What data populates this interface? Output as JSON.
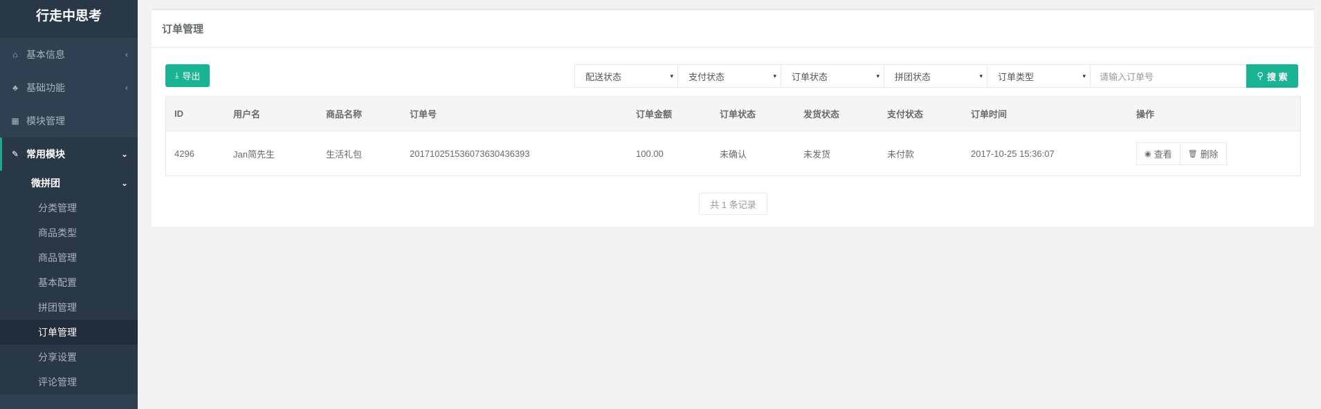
{
  "brand": {
    "title": "行走中思考"
  },
  "sidebar": {
    "items": [
      {
        "label": "基本信息",
        "icon": "home-icon",
        "glyph": "⌂",
        "chevron": "‹"
      },
      {
        "label": "基础功能",
        "icon": "sitemap-icon",
        "glyph": "♣",
        "chevron": "‹"
      },
      {
        "label": "模块管理",
        "icon": "grid-icon",
        "glyph": "▦",
        "chevron": ""
      },
      {
        "label": "常用模块",
        "icon": "edit-icon",
        "glyph": "✎",
        "chevron": "⌄"
      }
    ],
    "submenu": {
      "title": "微拼团",
      "chevron": "⌄",
      "items": [
        {
          "label": "分类管理"
        },
        {
          "label": "商品类型"
        },
        {
          "label": "商品管理"
        },
        {
          "label": "基本配置"
        },
        {
          "label": "拼团管理"
        },
        {
          "label": "订单管理"
        },
        {
          "label": "分享设置"
        },
        {
          "label": "评论管理"
        }
      ]
    }
  },
  "panel": {
    "title": "订单管理"
  },
  "toolbar": {
    "export_label": "导出",
    "export_icon": "⤓",
    "filters": [
      {
        "label": "配送状态"
      },
      {
        "label": "支付状态"
      },
      {
        "label": "订单状态"
      },
      {
        "label": "拼团状态"
      },
      {
        "label": "订单类型"
      }
    ],
    "caret": "▾",
    "search_placeholder": "请输入订单号",
    "search_label": "搜 索",
    "search_icon": "⚲"
  },
  "table": {
    "headers": [
      "ID",
      "用户名",
      "商品名称",
      "订单号",
      "订单金额",
      "订单状态",
      "发货状态",
      "支付状态",
      "订单时间",
      "操作"
    ],
    "rows": [
      {
        "id": "4296",
        "user": "Jan简先生",
        "product": "生活礼包",
        "order_no": "20171025153607363043639З",
        "amount": "100.00",
        "order_status": "未确认",
        "ship_status": "未发货",
        "pay_status": "未付款",
        "time": "2017-10-25 15:36:07",
        "view_label": "查看",
        "view_icon": "◉",
        "delete_label": "删除",
        "delete_icon": "🗑"
      }
    ]
  },
  "pager": {
    "text": "共 1 条记录"
  },
  "colors": {
    "accent": "#1ab394",
    "sidebar": "#2f4050",
    "sidebar_dark": "#293846"
  }
}
